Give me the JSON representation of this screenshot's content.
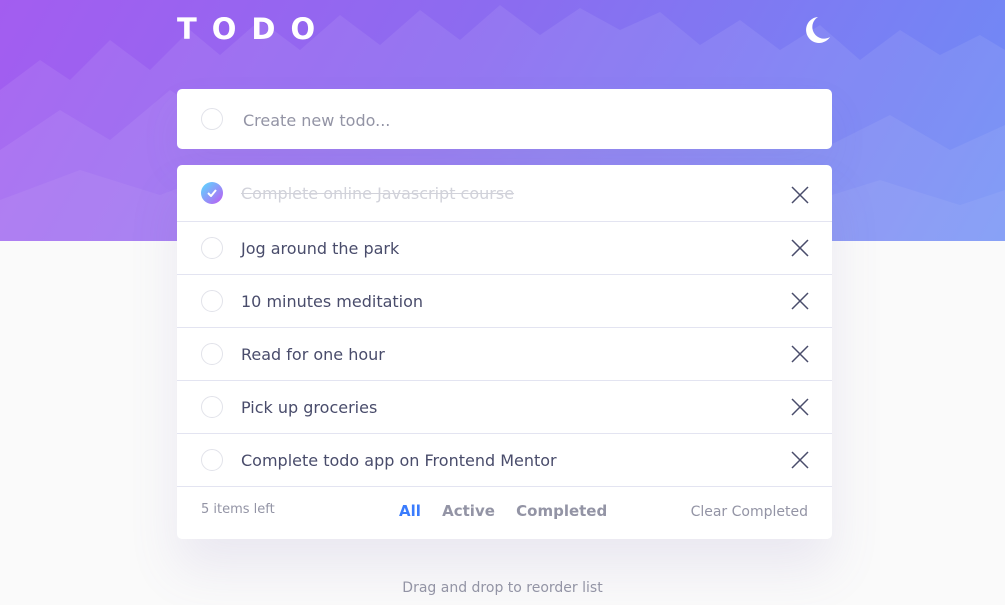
{
  "app": {
    "title": "TODO",
    "theme_icon": "moon-icon"
  },
  "create": {
    "placeholder": "Create new todo...",
    "value": ""
  },
  "todos": [
    {
      "text": "Complete online Javascript course",
      "completed": true
    },
    {
      "text": "Jog around the park",
      "completed": false
    },
    {
      "text": "10 minutes meditation",
      "completed": false
    },
    {
      "text": "Read for one hour",
      "completed": false
    },
    {
      "text": "Pick up groceries",
      "completed": false
    },
    {
      "text": "Complete todo app on Frontend Mentor",
      "completed": false
    }
  ],
  "footer": {
    "items_left": "5 items left",
    "filters": {
      "all": "All",
      "active": "Active",
      "completed": "Completed"
    },
    "active_filter": "All",
    "clear_label": "Clear Completed"
  },
  "hint": "Drag and drop to reorder list",
  "colors": {
    "accent": "#3a7cfd",
    "check_gradient_start": "#57ddff",
    "check_gradient_end": "#c058f3",
    "hero_start": "#a35df0",
    "hero_end": "#6d8df6"
  }
}
